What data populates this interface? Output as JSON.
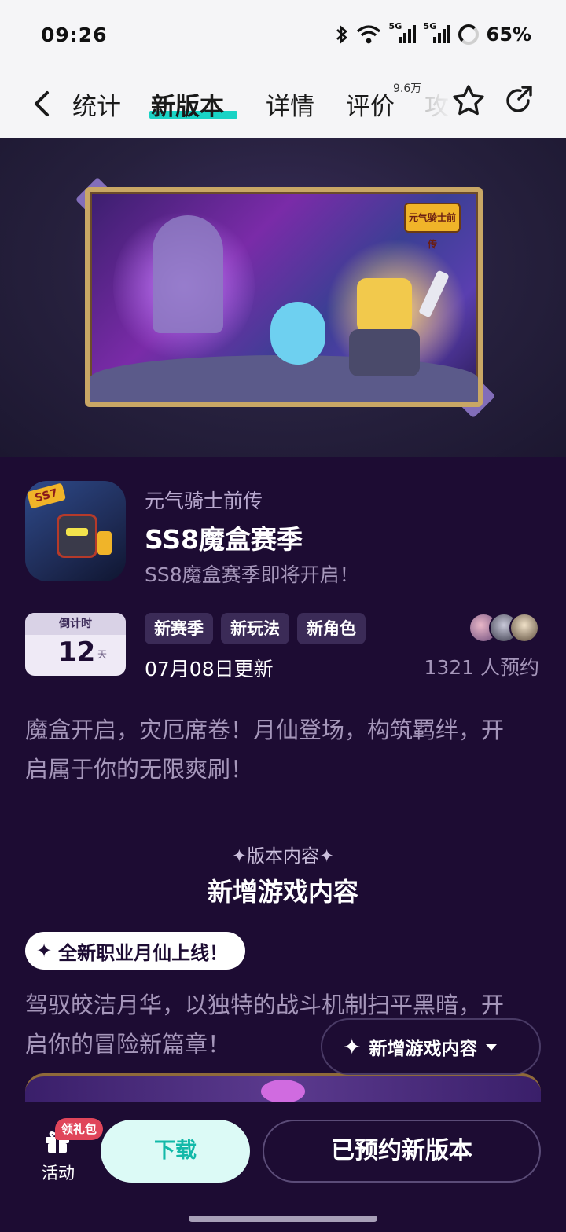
{
  "status": {
    "time": "09:26",
    "battery": "65%",
    "net1": "5G",
    "net2": "5G"
  },
  "nav": {
    "tabs": [
      {
        "label": "统计"
      },
      {
        "label": "新版本"
      },
      {
        "label": "详情"
      },
      {
        "label": "评价"
      },
      {
        "label": "攻"
      }
    ],
    "review_count": "9.6万",
    "active_tab": "新版本",
    "accent_color": "#19d3c5"
  },
  "banner": {
    "logo_text": "元气骑士前传"
  },
  "app": {
    "icon_badge": "SS7",
    "game_name": "元气骑士前传",
    "version_title": "SS8魔盒赛季",
    "version_subtitle": "SS8魔盒赛季即将开启！"
  },
  "countdown": {
    "label": "倒计时",
    "value": "12",
    "unit": "天"
  },
  "tags": [
    "新赛季",
    "新玩法",
    "新角色"
  ],
  "update_date": "07月08日更新",
  "reserve_count": "1321 人预约",
  "description": "魔盒开启，灾厄席卷！月仙登场，构筑羁绊，开启属于你的无限爽刷！",
  "section": {
    "kicker": "版本内容",
    "title": "新增游戏内容"
  },
  "feature": {
    "pill_label": "全新职业月仙上线！",
    "description": "驾驭皎洁月华，以独特的战斗机制扫平黑暗，开启你的冒险新篇章！"
  },
  "float_button": {
    "label": "新增游戏内容"
  },
  "bottom": {
    "activity_label": "活动",
    "gift_badge": "领礼包",
    "download_label": "下载",
    "reserved_label": "已预约新版本",
    "download_color": "#13b9a9"
  }
}
